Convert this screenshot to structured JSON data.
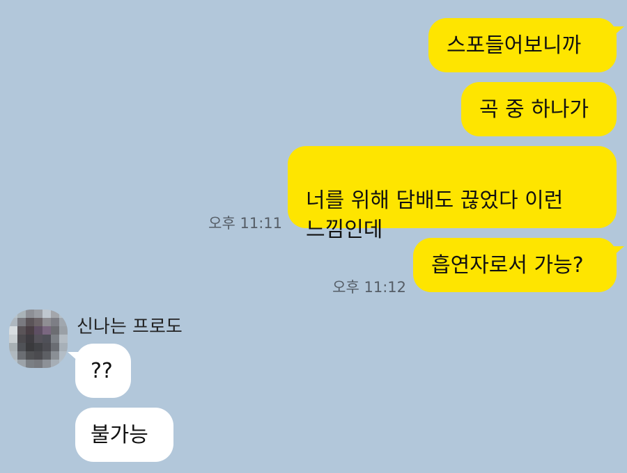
{
  "conversation": {
    "outgoing": [
      {
        "text": "스포들어보니까"
      },
      {
        "text": "곡 중 하나가"
      },
      {
        "text": "너를 위해 담배도 끊었다 이런\n느낌인데",
        "time": "오후 11:11"
      },
      {
        "text": "흡연자로서 가능?",
        "time": "오후 11:12"
      }
    ],
    "incoming": {
      "sender": "신나는 프로도",
      "messages": [
        {
          "text": "??"
        },
        {
          "text": "불가능"
        }
      ]
    }
  },
  "colors": {
    "background": "#b2c7da",
    "my_bubble": "#fee500",
    "their_bubble": "#ffffff"
  },
  "icons": {
    "avatar": "blurred-profile-avatar"
  }
}
